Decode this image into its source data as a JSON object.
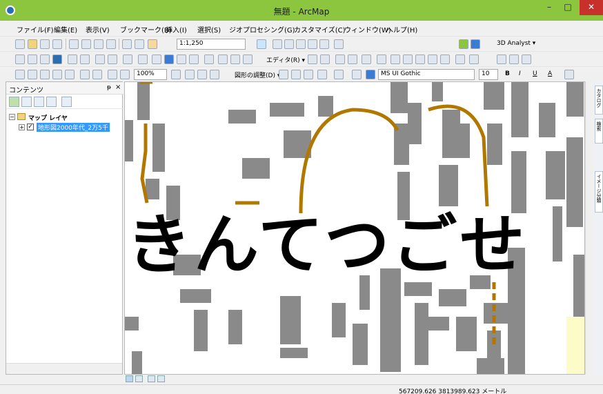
{
  "window": {
    "title": "無題 - ArcMap",
    "minimize": "–",
    "maximize": "□",
    "close": "✕"
  },
  "menu": [
    "ファイル(F)",
    "編集(E)",
    "表示(V)",
    "ブックマーク(B)",
    "挿入(I)",
    "選択(S)",
    "ジオプロセシング(G)",
    "カスタマイズ(C)",
    "ウィンドウ(W)",
    "ヘルプ(H)"
  ],
  "toolbar": {
    "scale": "1:1,250",
    "analyst": "3D Analyst ▾",
    "editor": "エディタ(R) ▾",
    "zoom_percent": "100%",
    "draw_menu": "図形の調整(D) ▾",
    "font_name": "MS UI Gothic",
    "font_size": "10",
    "bold": "B",
    "italic": "I",
    "underline": "U",
    "font_color": "A"
  },
  "toc": {
    "title": "コンテンツ",
    "pin": "ᵽ",
    "close": "×",
    "group_label": "マップ レイヤ",
    "layer_label": "地形図2000年代_2万5千",
    "expand_minus": "−",
    "expand_plus": "+",
    "check": "✓"
  },
  "side_tabs": [
    "カタログ",
    "検索",
    "イメージ分類"
  ],
  "map": {
    "overlay_text": "きんてつごせ",
    "road_color": "#b07800",
    "building_color": "#8a8a8a",
    "water_color": "#fdfbc8"
  },
  "status": {
    "coordinates": "567209.626  3813989.623 メートル"
  }
}
